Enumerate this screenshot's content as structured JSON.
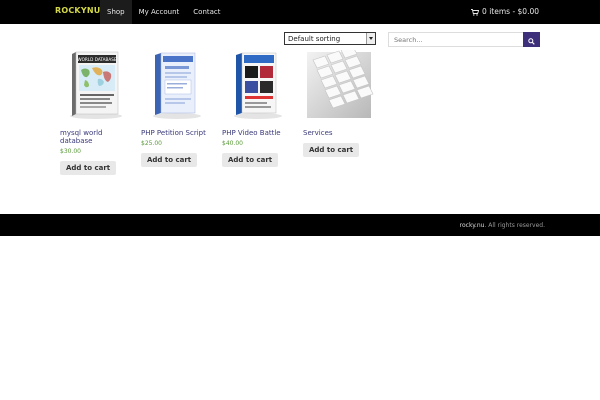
{
  "header": {
    "brand": "ROCKYNU",
    "nav": [
      {
        "label": "Shop"
      },
      {
        "label": "My Account"
      },
      {
        "label": "Contact"
      }
    ],
    "cart_label": "0 items - $0.00",
    "cart_icon": "cart-icon"
  },
  "toolbar": {
    "sort_selected": "Default sorting",
    "search_placeholder": "Search...",
    "search_icon": "search-icon"
  },
  "products": [
    {
      "title": "mysql world database",
      "price": "$30.00",
      "button": "Add to cart",
      "image": "world-database-box"
    },
    {
      "title": "PHP Petition Script",
      "price": "$25.00",
      "button": "Add to cart",
      "image": "petition-script-box"
    },
    {
      "title": "PHP Video Battle",
      "price": "$40.00",
      "button": "Add to cart",
      "image": "video-battle-box"
    },
    {
      "title": "Services",
      "price": "",
      "button": "Add to cart",
      "image": "keyboard-photo"
    }
  ],
  "footer": {
    "site": "rocky.nu",
    "rights": ". All rights reserved."
  },
  "colors": {
    "topbar": "#000000",
    "brand": "#d4d84a",
    "search_button": "#3e2f7a",
    "price": "#5a9a3a",
    "link": "#3a3a7a"
  }
}
